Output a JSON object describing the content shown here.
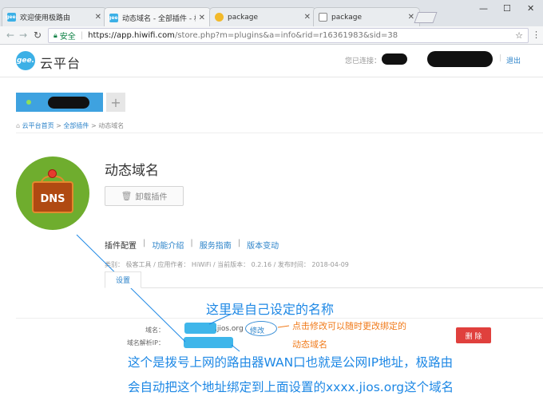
{
  "browser": {
    "tabs": [
      {
        "label": "欢迎使用极路由",
        "icon": "gee-favicon",
        "color": "#3cb0e6",
        "icon_text": "gee."
      },
      {
        "label": "动态域名 - 全部插件 - 极",
        "icon": "gee-favicon",
        "color": "#3cb0e6",
        "icon_text": "gee."
      },
      {
        "label": "package",
        "icon": "chrome-favicon",
        "color": "#f2b92a",
        "icon_text": ""
      },
      {
        "label": "package",
        "icon": "document-icon",
        "color": "#ffffff",
        "icon_text": ""
      }
    ],
    "secure_label": "安全",
    "url_host": "https://app.hiwifi.com",
    "url_path": "/store.php?m=plugins&a=info&rid=r16361983&sid=38"
  },
  "header": {
    "logo_text": "云平台",
    "logo_icon_text": "gee.",
    "connected_label": "您已连接：",
    "logout": "退出"
  },
  "breadcrumb": {
    "home": "云平台首页",
    "sep1": ">",
    "all_plugins": "全部插件",
    "sep2": ">",
    "current": "动态域名"
  },
  "plugin": {
    "icon_text": "DNS",
    "title": "动态域名",
    "uninstall_label": "卸载插件",
    "tabs": [
      "插件配置",
      "功能介绍",
      "服务指南",
      "版本变动"
    ],
    "tab_sep": "|",
    "meta": "类别： 极客工具 / 应用作者： HiWiFi / 当前版本： 0.2.16 / 发布时间： 2018-04-09",
    "settings_tab": "设置"
  },
  "settings": {
    "domain_label": "域名：",
    "domain_suffix": ".jios.org",
    "edit_label": "修改",
    "ip_label": "域名解析IP：",
    "delete_label": "删 除"
  },
  "annotations": {
    "name_note": "这里是自己设定的名称",
    "edit_note_1": "点击修改可以随时更改绑定的",
    "edit_note_2": "动态域名",
    "wan_note_1": "这个是拨号上网的路由器WAN口也就是公网IP地址，极路由",
    "wan_note_2": "会自动把这个地址绑定到上面设置的xxxx.jios.org这个域名"
  },
  "colors": {
    "accent": "#2a82c9",
    "annotation_blue": "#1e88e5",
    "annotation_orange": "#f07a1a",
    "delete": "#e0403d",
    "dns_green": "#6fad2e"
  }
}
